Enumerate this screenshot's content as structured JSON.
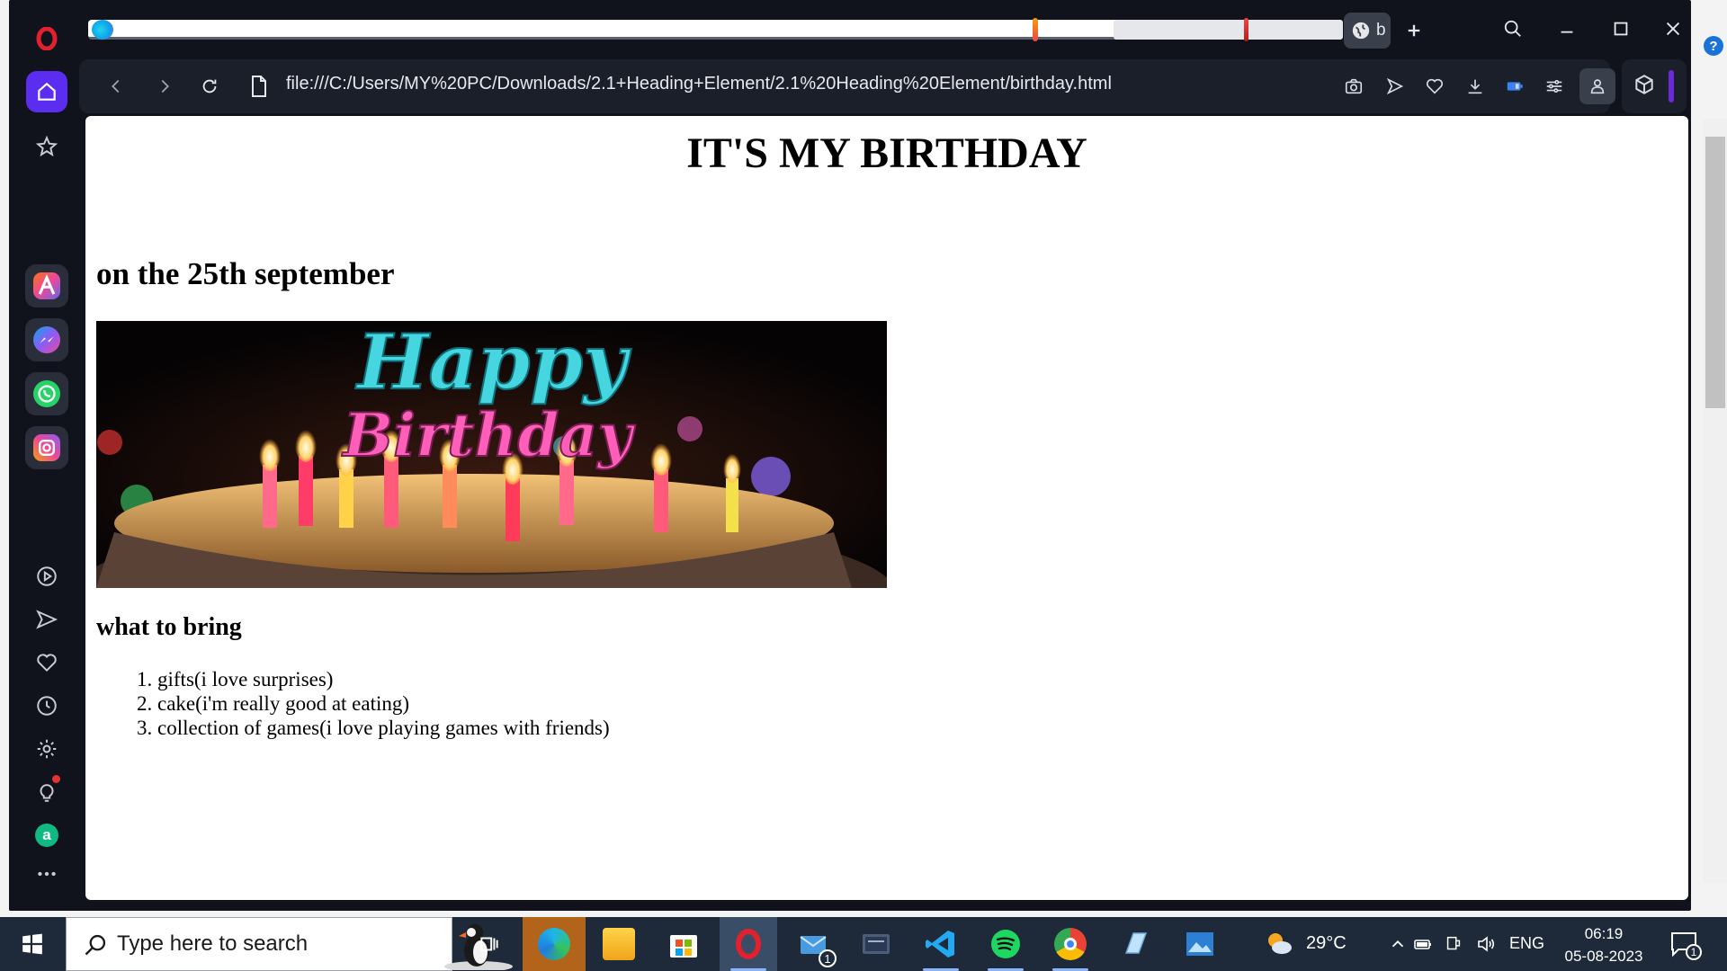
{
  "browser": {
    "active_tab_label": "b",
    "url": "file:///C:/Users/MY%20PC/Downloads/2.1+Heading+Element/2.1%20Heading%20Element/birthday.html"
  },
  "page": {
    "title": "IT'S MY BIRTHDAY",
    "date_heading": "on the 25th september",
    "image_text_line1": "Happy",
    "image_text_line2": "Birthday",
    "bring_heading": "what to bring",
    "bring_items": [
      "gifts(i love surprises)",
      "cake(i'm really good at eating)",
      "collection of games(i love playing games with friends)"
    ]
  },
  "sidebar": {
    "apps": [
      "aria-icon",
      "messenger-icon",
      "whatsapp-icon",
      "instagram-icon"
    ],
    "assistant_letter": "a"
  },
  "taskbar": {
    "search_placeholder": "Type here to search",
    "mail_badge": "1",
    "temperature": "29°C",
    "language": "ENG",
    "time": "06:19",
    "date": "05-08-2023",
    "notification_count": "1"
  },
  "colors": {
    "browser_bg": "#10131b",
    "toolbar_bg": "#1b1f29",
    "home_accent": "#5b2df0",
    "taskbar_bg": "#1e2a3a",
    "opera_red": "#e2202e"
  }
}
